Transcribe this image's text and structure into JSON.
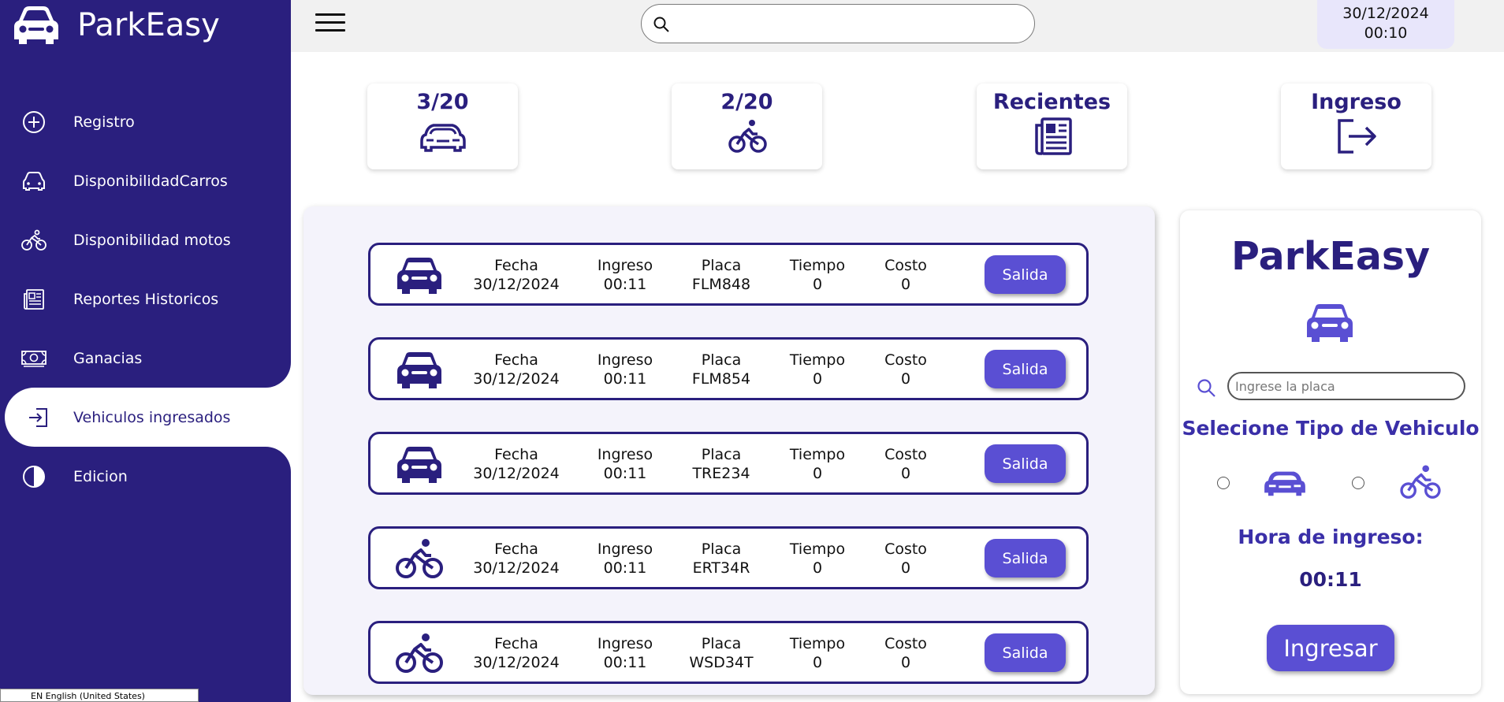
{
  "app": {
    "name": "ParkEasy"
  },
  "sidebar": {
    "items": [
      {
        "label": "Registro",
        "icon": "plus-circle-icon"
      },
      {
        "label": "DisponibilidadCarros",
        "icon": "car-icon"
      },
      {
        "label": "Disponibilidad motos",
        "icon": "bicycle-icon"
      },
      {
        "label": "Reportes Historicos",
        "icon": "newspaper-icon"
      },
      {
        "label": "Ganacias",
        "icon": "money-icon"
      },
      {
        "label": "Vehiculos ingresados",
        "icon": "sign-in-icon",
        "active": true
      },
      {
        "label": "Edicion",
        "icon": "contrast-icon"
      }
    ]
  },
  "topbar": {
    "search_value": "",
    "date": "30/12/2024",
    "time": "00:10"
  },
  "stats": [
    {
      "title": "3/20",
      "icon": "car-icon"
    },
    {
      "title": "2/20",
      "icon": "bicycle-icon"
    },
    {
      "title": "Recientes",
      "icon": "newspaper-icon"
    },
    {
      "title": "Ingreso",
      "icon": "sign-out-icon"
    }
  ],
  "list": {
    "headers": {
      "fecha": "Fecha",
      "ingreso": "Ingreso",
      "placa": "Placa",
      "tiempo": "Tiempo",
      "costo": "Costo"
    },
    "button_label": "Salida",
    "rows": [
      {
        "type": "car",
        "fecha": "30/12/2024",
        "ingreso": "00:11",
        "placa": "FLM848",
        "tiempo": "0",
        "costo": "0"
      },
      {
        "type": "car",
        "fecha": "30/12/2024",
        "ingreso": "00:11",
        "placa": "FLM854",
        "tiempo": "0",
        "costo": "0"
      },
      {
        "type": "car",
        "fecha": "30/12/2024",
        "ingreso": "00:11",
        "placa": "TRE234",
        "tiempo": "0",
        "costo": "0"
      },
      {
        "type": "bike",
        "fecha": "30/12/2024",
        "ingreso": "00:11",
        "placa": "ERT34R",
        "tiempo": "0",
        "costo": "0"
      },
      {
        "type": "bike",
        "fecha": "30/12/2024",
        "ingreso": "00:11",
        "placa": "WSD34T",
        "tiempo": "0",
        "costo": "0"
      }
    ]
  },
  "register_panel": {
    "title": "ParkEasy",
    "plate_placeholder": "Ingrese la placa",
    "select_label": "Selecione Tipo de Vehiculo",
    "hora_label": "Hora de ingreso:",
    "hora_value": "00:11",
    "submit_label": "Ingresar"
  },
  "taskbar": {
    "language": "EN English (United States)"
  },
  "colors": {
    "primary": "#2a1f7e",
    "accent": "#5a4fd3",
    "panel_bg": "#f4f3fb"
  }
}
